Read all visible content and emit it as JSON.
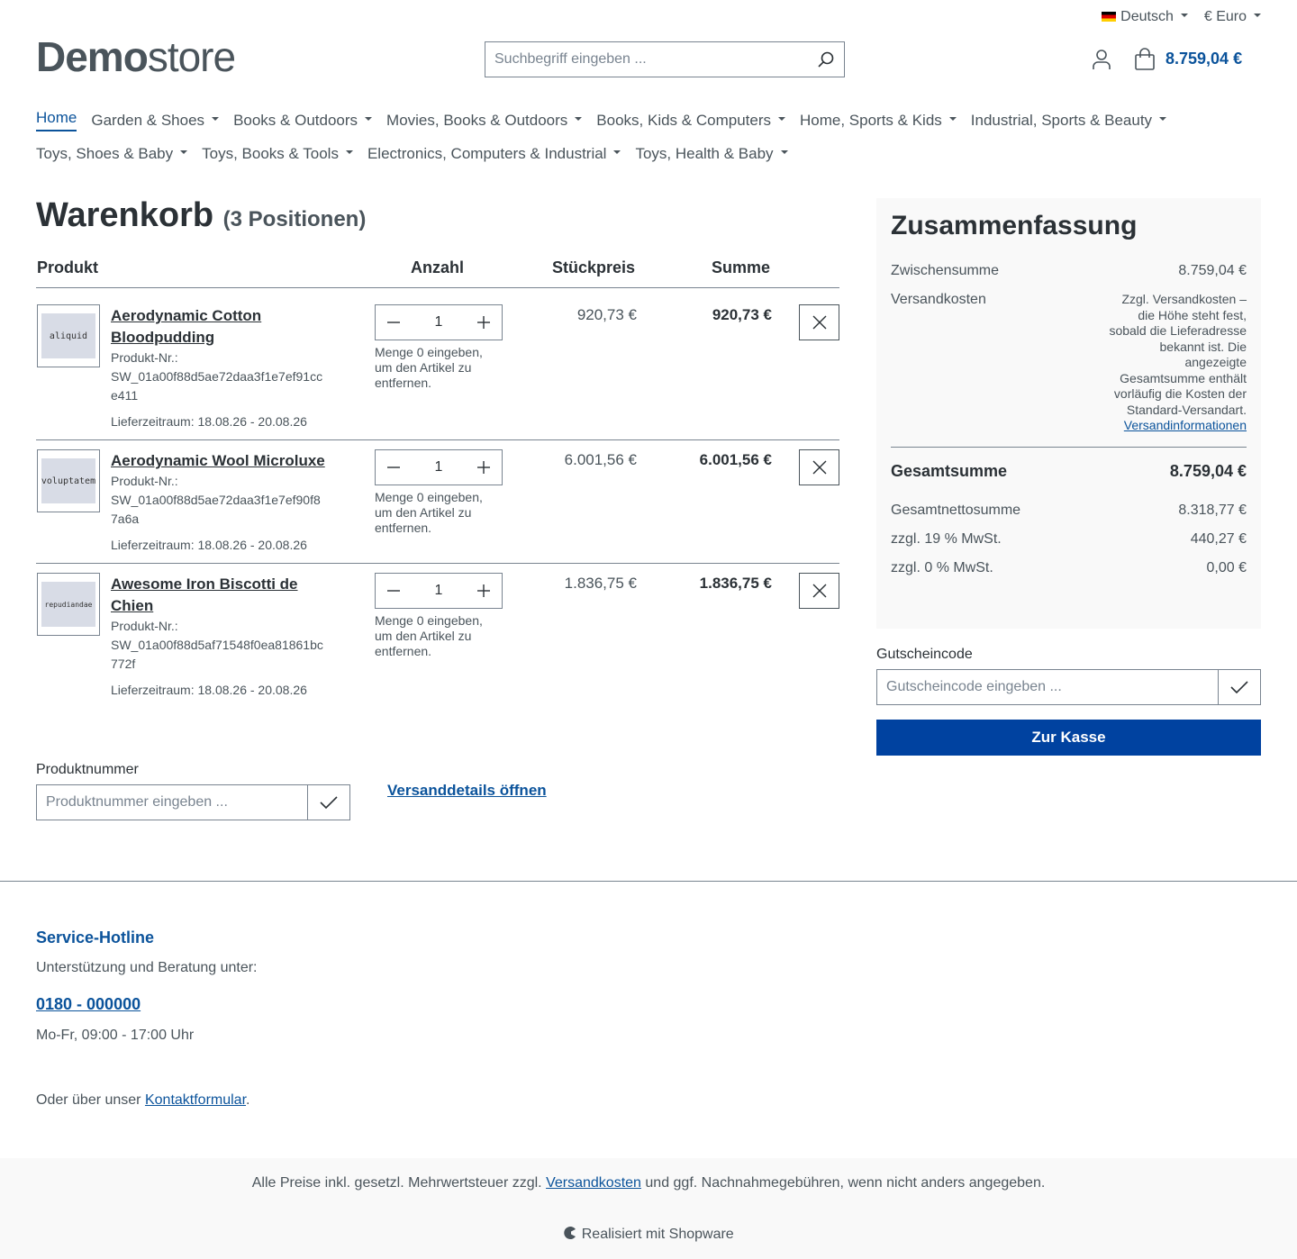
{
  "topbar": {
    "language": "Deutsch",
    "currency": "€ Euro"
  },
  "logo": {
    "bold": "Demo",
    "light": "store"
  },
  "search": {
    "placeholder": "Suchbegriff eingeben ..."
  },
  "header": {
    "cart_total": "8.759,04 €"
  },
  "nav": {
    "row1": [
      "Home",
      "Garden & Shoes",
      "Books & Outdoors",
      "Movies, Books & Outdoors",
      "Books, Kids & Computers",
      "Home, Sports & Kids",
      "Industrial, Sports & Beauty"
    ],
    "row2": [
      "Toys, Shoes & Baby",
      "Toys, Books & Tools",
      "Electronics, Computers & Industrial",
      "Toys, Health & Baby"
    ]
  },
  "cart": {
    "title": "Warenkorb",
    "count": "(3 Positionen)",
    "headers": {
      "product": "Produkt",
      "qty": "Anzahl",
      "unit": "Stückpreis",
      "sum": "Summe"
    },
    "qty_hint": "Menge 0 eingeben, um den Artikel zu entfernen.",
    "items": [
      {
        "thumb": "aliquid",
        "name": "Aerodynamic Cotton Bloodpudding",
        "number_label": "Produkt-Nr.:",
        "number": "SW_01a00f88d5ae72daa3f1e7ef91cce411",
        "delivery": "Lieferzeitraum: 18.08.26 - 20.08.26",
        "qty": "1",
        "unit": "920,73 €",
        "sum": "920,73 €"
      },
      {
        "thumb": "voluptatem",
        "name": "Aerodynamic Wool Microluxe",
        "number_label": "Produkt-Nr.:",
        "number": "SW_01a00f88d5ae72daa3f1e7ef90f87a6a",
        "delivery": "Lieferzeitraum: 18.08.26 - 20.08.26",
        "qty": "1",
        "unit": "6.001,56 €",
        "sum": "6.001,56 €"
      },
      {
        "thumb": "repudiandae",
        "name": "Awesome Iron Biscotti de Chien",
        "number_label": "Produkt-Nr.:",
        "number": "SW_01a00f88d5af71548f0ea81861bc772f",
        "delivery": "Lieferzeitraum: 18.08.26 - 20.08.26",
        "qty": "1",
        "unit": "1.836,75 €",
        "sum": "1.836,75 €"
      }
    ]
  },
  "product_number": {
    "label": "Produktnummer",
    "placeholder": "Produktnummer eingeben ..."
  },
  "shipping_link": "Versanddetails öffnen",
  "summary": {
    "title": "Zusammenfassung",
    "subtotal_label": "Zwischensumme",
    "subtotal": "8.759,04 €",
    "shipping_label": "Versandkosten",
    "shipping_text": "Zzgl. Versandkosten – die Höhe steht fest, sobald die Lieferadresse bekannt ist. Die angezeigte Gesamtsumme enthält vorläufig die Kosten der Standard-Versandart.",
    "shipping_info_link": "Versandinformationen",
    "total_label": "Gesamtsumme",
    "total": "8.759,04 €",
    "net_label": "Gesamtnettosumme",
    "net": "8.318,77 €",
    "vat19_label": "zzgl. 19 % MwSt.",
    "vat19": "440,27 €",
    "vat0_label": "zzgl. 0 % MwSt.",
    "vat0": "0,00 €"
  },
  "voucher": {
    "label": "Gutscheincode",
    "placeholder": "Gutscheincode eingeben ..."
  },
  "checkout_button": "Zur Kasse",
  "footer": {
    "hotline_title": "Service-Hotline",
    "hotline_text": "Unterstützung und Beratung unter:",
    "phone": "0180 - 000000",
    "hours": "Mo-Fr, 09:00 - 17:00 Uhr",
    "contact_prefix": "Oder über unser",
    "contact_link": "Kontaktformular",
    "contact_suffix": ".",
    "vat_prefix": "Alle Preise inkl. gesetzl. Mehrwertsteuer zzgl.",
    "vat_link": "Versandkosten",
    "vat_suffix": "und ggf. Nachnahmegebühren, wenn nicht anders angegeben.",
    "powered": "Realisiert mit Shopware"
  },
  "colors": {
    "primary": "#0042a0",
    "link": "#0b539b",
    "text": "#4a545b"
  }
}
